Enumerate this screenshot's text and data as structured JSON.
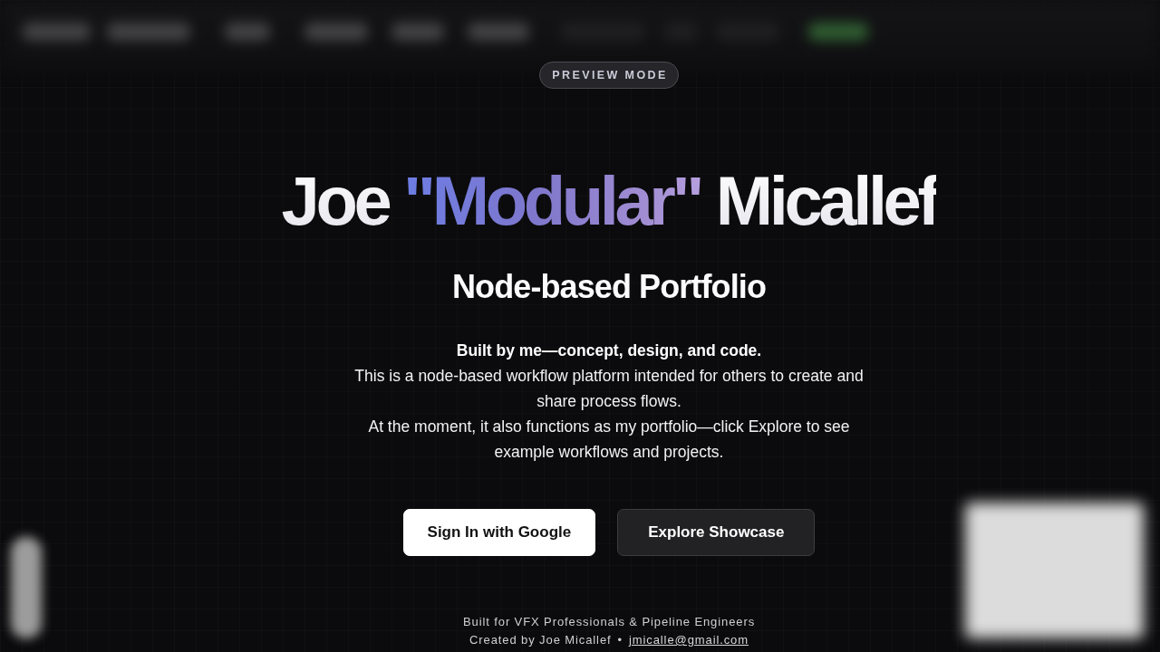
{
  "badge": {
    "label": "PREVIEW MODE"
  },
  "hero": {
    "title": [
      {
        "text": "Joe ",
        "kind": "plain"
      },
      {
        "text": "\"Modular\"",
        "kind": "accent"
      },
      {
        "text": " Micallef",
        "kind": "plain"
      }
    ],
    "subtitle": "Node-based Portfolio"
  },
  "intro": {
    "lead": "Built by me—concept, design, and code.",
    "paragraphs": [
      "This is a node-based workflow platform intended for others to create and share process flows.",
      "At the moment, it also functions as my portfolio—click Explore to see example workflows and projects."
    ]
  },
  "actions": [
    {
      "label": "Sign In with Google",
      "kind": "primary"
    },
    {
      "label": "Explore Showcase",
      "kind": "secondary"
    }
  ],
  "footer": {
    "tagline": "Built for VFX Professionals & Pipeline Engineers",
    "credit": "Created by Joe Micallef",
    "separator": "•",
    "email": "jmicalle@gmail.com"
  }
}
